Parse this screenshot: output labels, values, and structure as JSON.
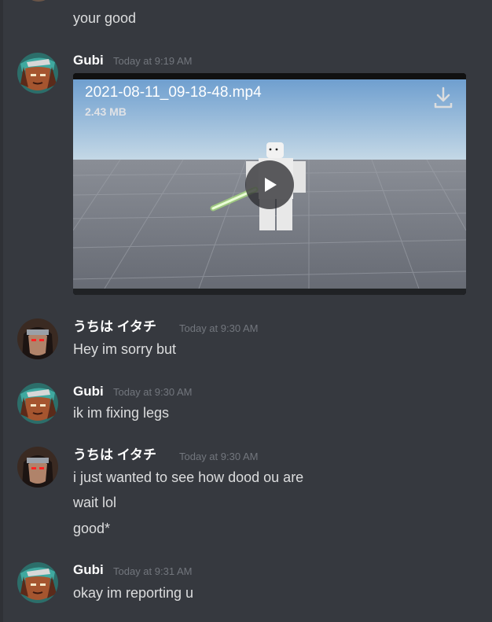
{
  "colors": {
    "background": "#36393f",
    "text": "#dcddde",
    "author": "#ffffff",
    "timestamp": "#72767d"
  },
  "messages": [
    {
      "type": "continuation",
      "text": "your good"
    },
    {
      "type": "group",
      "author": "Gubi",
      "timestamp": "Today at 9:19 AM",
      "avatar": "gubi-avatar",
      "attachment": {
        "kind": "video",
        "filename": "2021-08-11_09-18-48.mp4",
        "size": "2.43 MB",
        "icons": [
          "download-icon",
          "play-icon"
        ]
      }
    },
    {
      "type": "group",
      "author": "うちは イタチ",
      "timestamp": "Today at 9:30 AM",
      "avatar": "itachi-avatar",
      "lines": [
        "Hey im sorry but"
      ]
    },
    {
      "type": "group",
      "author": "Gubi",
      "timestamp": "Today at 9:30 AM",
      "avatar": "gubi-avatar",
      "lines": [
        "ik im fixing legs"
      ]
    },
    {
      "type": "group",
      "author": "うちは イタチ",
      "timestamp": "Today at 9:30 AM",
      "avatar": "itachi-avatar",
      "lines": [
        "i just wanted to see how dood ou are",
        "wait lol",
        "good*"
      ]
    },
    {
      "type": "group",
      "author": "Gubi",
      "timestamp": "Today at 9:31 AM",
      "avatar": "gubi-avatar",
      "lines": [
        "okay im reporting u"
      ]
    }
  ]
}
